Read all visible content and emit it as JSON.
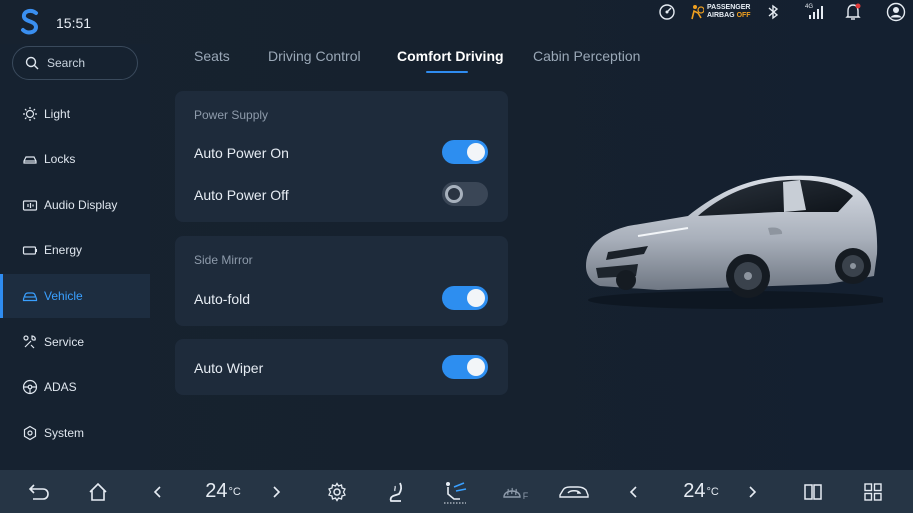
{
  "status_bar": {
    "time": "15:51",
    "airbag_line1": "PASSENGER",
    "airbag_line2": "AIRBAG",
    "airbag_state": "OFF",
    "network": "4G",
    "icons": [
      "steering-wheel-speed-icon",
      "airbag-icon",
      "bluetooth-icon",
      "cellular-signal-icon",
      "notification-bell-icon",
      "user-account-icon"
    ],
    "notification_dot_color": "#e03a3a"
  },
  "sidebar": {
    "search_placeholder": "Search",
    "items": [
      {
        "label": "Light",
        "icon": "light-icon"
      },
      {
        "label": "Locks",
        "icon": "locks-icon"
      },
      {
        "label": "Audio Display",
        "icon": "audio-display-icon"
      },
      {
        "label": "Energy",
        "icon": "energy-icon"
      },
      {
        "label": "Vehicle",
        "icon": "vehicle-icon",
        "active": true
      },
      {
        "label": "Service",
        "icon": "service-icon"
      },
      {
        "label": "ADAS",
        "icon": "adas-icon"
      },
      {
        "label": "System",
        "icon": "system-icon"
      }
    ]
  },
  "tabs": [
    {
      "label": "Seats"
    },
    {
      "label": "Driving Control"
    },
    {
      "label": "Comfort Driving",
      "active": true
    },
    {
      "label": "Cabin Perception"
    }
  ],
  "cards": {
    "power_supply": {
      "title": "Power Supply",
      "rows": [
        {
          "label": "Auto Power On",
          "on": true
        },
        {
          "label": "Auto Power Off",
          "on": false
        }
      ]
    },
    "side_mirror": {
      "title": "Side Mirror",
      "rows": [
        {
          "label": "Auto-fold",
          "on": true
        }
      ]
    },
    "wiper": {
      "rows": [
        {
          "label": "Auto Wiper",
          "on": true
        }
      ]
    }
  },
  "dock": {
    "left_temp": "24",
    "right_temp": "24",
    "temp_unit": "°C",
    "defrost_label": "F",
    "icons": [
      "back-icon",
      "home-icon",
      "chevron-left-icon",
      "chevron-right-icon",
      "settings-gear-icon",
      "seat-heat-icon",
      "airflow-mode-icon",
      "front-defrost-icon",
      "car-recirculation-icon",
      "chevron-left-icon",
      "chevron-right-icon",
      "split-screen-icon",
      "app-grid-icon"
    ]
  },
  "colors": {
    "accent": "#2f8cf0",
    "background": "#17222f",
    "card": "#1e2b3b",
    "dock": "#263545"
  }
}
